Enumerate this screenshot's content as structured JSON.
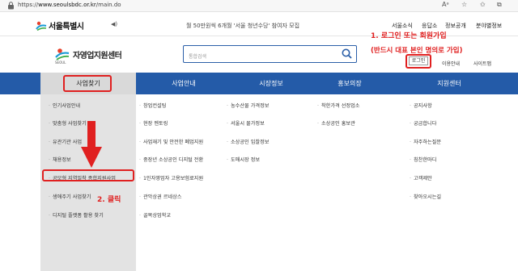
{
  "browser": {
    "url_prefix": "https://",
    "url_host": "www.seoulsbdc.or.kr",
    "url_path": "/main.do"
  },
  "utility": {
    "seoul_logo_text": "서울특별시",
    "notice": "월 50만원씩 6개월 '서울 청년수당' 참여자 모집",
    "links": [
      "서울소식",
      "응답소",
      "정보공개",
      "분야별정보"
    ]
  },
  "header": {
    "logo_text": "자영업지원센터",
    "logo_sub": "SEOUL",
    "search_placeholder": "통합검색",
    "login_label": "로그인",
    "links": [
      "이용안내",
      "사이트맵"
    ]
  },
  "annotations": {
    "step1_line1": "1. 로그인 또는 회원가입",
    "step1_line2": "(반드시 대표 본인 명의로 가입)",
    "step2": "2. 클릭"
  },
  "nav": [
    "사업찾기",
    "사업안내",
    "시장정보",
    "홍보의장",
    "지원센터"
  ],
  "menu": {
    "col1": [
      "인기사업안내",
      "맞춤형 사업찾기",
      "유관기관 사업",
      "채용정보",
      "공모형 지역밀착 종합지원사업",
      "생애주기 사업찾기",
      "디지털 플랫폼 활용 찾기"
    ],
    "col2": [
      "창업컨설팅",
      "현장 멘토링",
      "사업재기 및 안전한 폐업지원",
      "중장년 소상공인 디지털 전환",
      "1인자영업자 고용보험료지원",
      "관악상권 르네상스",
      "골목상업학교"
    ],
    "col3": [
      "농수산물 가격정보",
      "서울시 물가정보",
      "소상공인 입찰정보",
      "도매시장 정보"
    ],
    "col4": [
      "착한가격 선정업소",
      "소상공인 홍보관"
    ],
    "col5": [
      "공지사항",
      "궁금합니다",
      "자주하는질문",
      "칭찬한마디",
      "고객제안",
      "찾아오시는길"
    ]
  },
  "colors": {
    "nav_bg": "#245ba8",
    "annotation_red": "#e02020",
    "active_bg": "#d9d9d9"
  },
  "icons": [
    "lock-icon",
    "speaker-icon",
    "search-icon",
    "seoul-logo-icon",
    "sbdc-logo-icon",
    "red-arrow-icon"
  ]
}
